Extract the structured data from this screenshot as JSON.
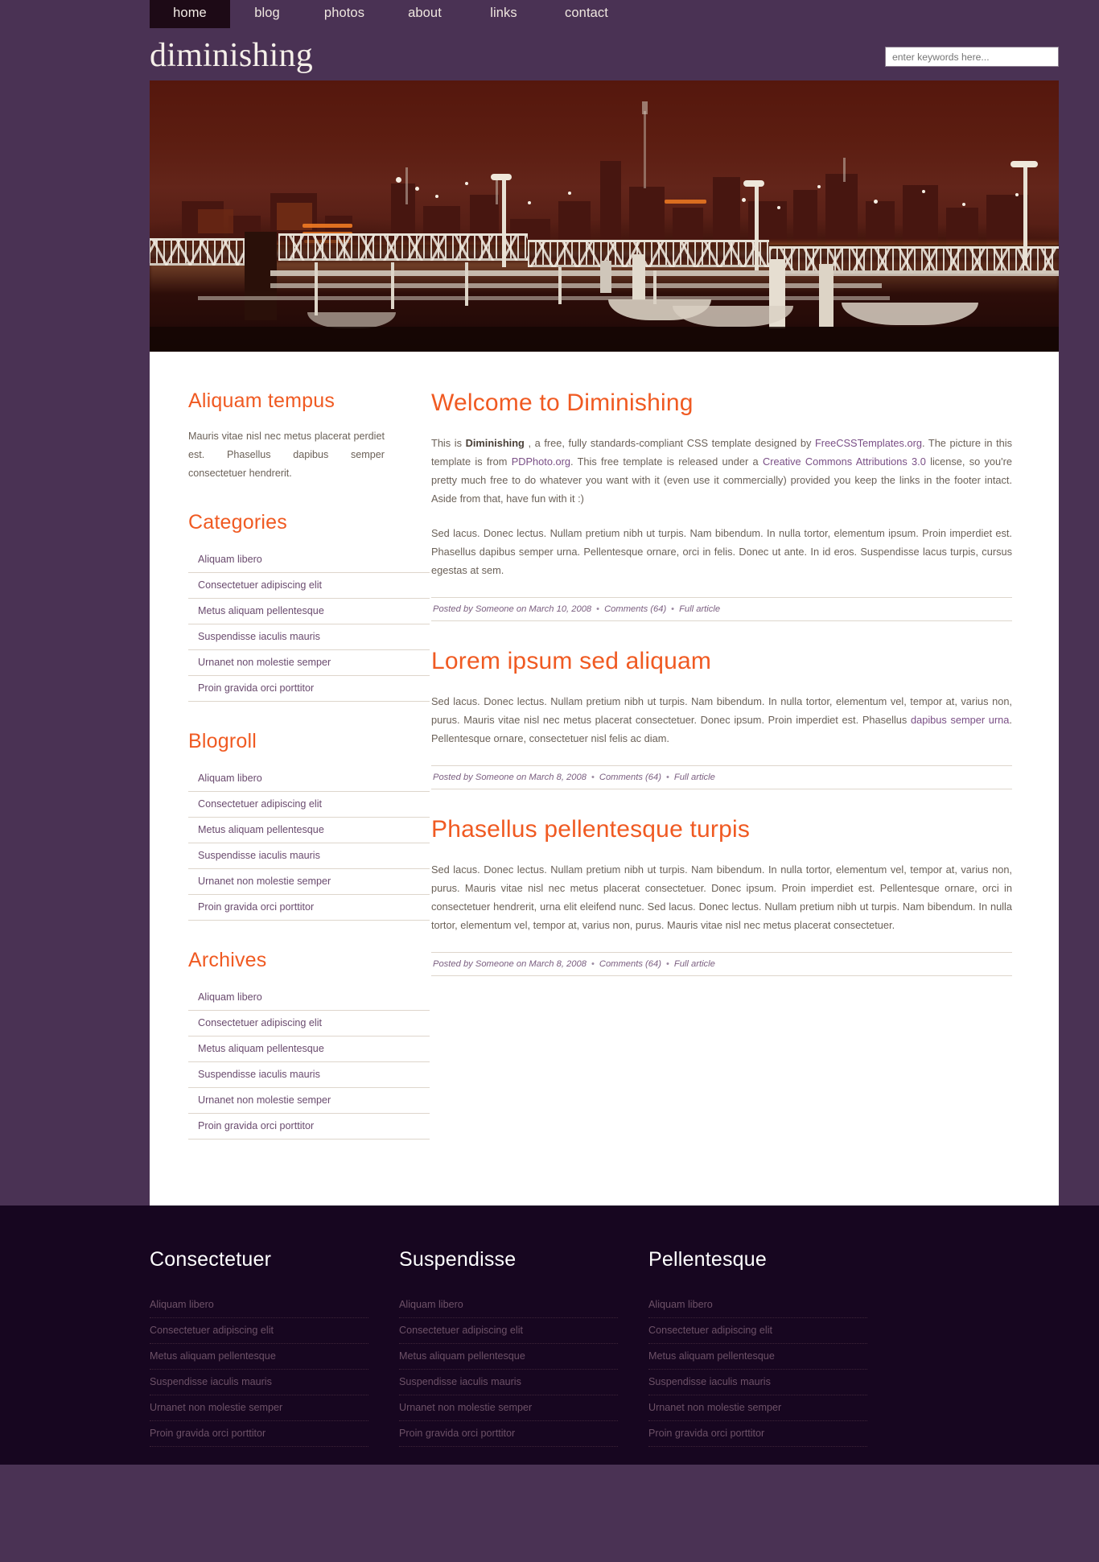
{
  "colors": {
    "page_bg": "#4a3254",
    "accent_orange": "#f05a22",
    "link_purple": "#7a4f86",
    "footer_bg": "#170620",
    "nav_active_bg": "#1d0a16"
  },
  "nav": {
    "items": [
      {
        "label": "home",
        "active": true
      },
      {
        "label": "blog",
        "active": false
      },
      {
        "label": "photos",
        "active": false
      },
      {
        "label": "about",
        "active": false
      },
      {
        "label": "links",
        "active": false
      },
      {
        "label": "contact",
        "active": false
      }
    ]
  },
  "header": {
    "logo": "diminishing",
    "search_placeholder": "enter keywords here...",
    "search_value": ""
  },
  "banner": {
    "alt": "night harbor cityscape with docks"
  },
  "sidebar": {
    "intro": {
      "title": "Aliquam tempus",
      "text": "Mauris vitae nisl nec metus placerat perdiet est. Phasellus dapibus semper consectetuer hendrerit."
    },
    "blocks": [
      {
        "title": "Categories",
        "items": [
          "Aliquam libero",
          "Consectetuer adipiscing elit",
          "Metus aliquam pellentesque",
          "Suspendisse iaculis mauris",
          "Urnanet non molestie semper",
          "Proin gravida orci porttitor"
        ]
      },
      {
        "title": "Blogroll",
        "items": [
          "Aliquam libero",
          "Consectetuer adipiscing elit",
          "Metus aliquam pellentesque",
          "Suspendisse iaculis mauris",
          "Urnanet non molestie semper",
          "Proin gravida orci porttitor"
        ]
      },
      {
        "title": "Archives",
        "items": [
          "Aliquam libero",
          "Consectetuer adipiscing elit",
          "Metus aliquam pellentesque",
          "Suspendisse iaculis mauris",
          "Urnanet non molestie semper",
          "Proin gravida orci porttitor"
        ]
      }
    ]
  },
  "posts": [
    {
      "title": "Welcome to Diminishing",
      "p1_a": "This is ",
      "p1_strong": "Diminishing",
      "p1_b": " , a free, fully standards-compliant CSS template designed by ",
      "p1_link1": "FreeCSSTemplates.org",
      "p1_c": ". The picture in this template is from ",
      "p1_link2": "PDPhoto.org",
      "p1_d": ". This free template is released under a ",
      "p1_link3": "Creative Commons Attributions 3.0",
      "p1_e": " license, so you're pretty much free to do whatever you want with it (even use it commercially) provided you keep the links in the footer intact. Aside from that, have fun with it :)",
      "p2": "Sed lacus. Donec lectus. Nullam pretium nibh ut turpis. Nam bibendum. In nulla tortor, elementum ipsum. Proin imperdiet est. Phasellus dapibus semper urna. Pellentesque ornare, orci in felis. Donec ut ante. In id eros. Suspendisse lacus turpis, cursus egestas at sem.",
      "meta_posted": "Posted by Someone on March 10, 2008",
      "meta_comments": "Comments (64)",
      "meta_full": "Full article"
    },
    {
      "title": "Lorem ipsum sed aliquam",
      "p1_a": "Sed lacus. Donec lectus. Nullam pretium nibh ut turpis. Nam bibendum. In nulla tortor, elementum vel, tempor at, varius non, purus. Mauris vitae nisl nec metus placerat consectetuer. Donec ipsum. Proin imperdiet est. Phasellus ",
      "p1_link": "dapibus semper urna",
      "p1_b": ". Pellentesque ornare, consectetuer nisl felis ac diam.",
      "meta_posted": "Posted by Someone on March 8, 2008",
      "meta_comments": "Comments (64)",
      "meta_full": "Full article"
    },
    {
      "title": "Phasellus pellentesque turpis",
      "p1": "Sed lacus. Donec lectus. Nullam pretium nibh ut turpis. Nam bibendum. In nulla tortor, elementum vel, tempor at, varius non, purus. Mauris vitae nisl nec metus placerat consectetuer. Donec ipsum. Proin imperdiet est. Pellentesque ornare, orci in consectetuer hendrerit, urna elit eleifend nunc. Sed lacus. Donec lectus. Nullam pretium nibh ut turpis. Nam bibendum. In nulla tortor, elementum vel, tempor at, varius non, purus. Mauris vitae nisl nec metus placerat consectetuer.",
      "meta_posted": "Posted by Someone on March 8, 2008",
      "meta_comments": "Comments (64)",
      "meta_full": "Full article"
    }
  ],
  "footer": {
    "columns": [
      {
        "title": "Consectetuer",
        "items": [
          "Aliquam libero",
          "Consectetuer adipiscing elit",
          "Metus aliquam pellentesque",
          "Suspendisse iaculis mauris",
          "Urnanet non molestie semper",
          "Proin gravida orci porttitor"
        ]
      },
      {
        "title": "Suspendisse",
        "items": [
          "Aliquam libero",
          "Consectetuer adipiscing elit",
          "Metus aliquam pellentesque",
          "Suspendisse iaculis mauris",
          "Urnanet non molestie semper",
          "Proin gravida orci porttitor"
        ]
      },
      {
        "title": "Pellentesque",
        "items": [
          "Aliquam libero",
          "Consectetuer adipiscing elit",
          "Metus aliquam pellentesque",
          "Suspendisse iaculis mauris",
          "Urnanet non molestie semper",
          "Proin gravida orci porttitor"
        ]
      }
    ]
  }
}
